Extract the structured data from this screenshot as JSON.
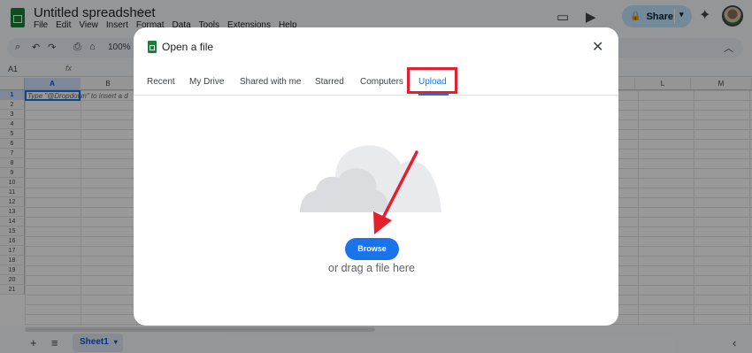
{
  "app": {
    "doc_title": "Untitled spreadsheet",
    "menu": [
      "File",
      "Edit",
      "View",
      "Insert",
      "Format",
      "Data",
      "Tools",
      "Extensions",
      "Help"
    ],
    "share_label": "Share",
    "zoom": "100%",
    "cell_ref": "A1",
    "fx": "fx",
    "cell_hint": "Type \"@Dropdown\" to insert a d",
    "columns": [
      "A",
      "B",
      "L",
      "M"
    ],
    "rows": [
      "1",
      "2",
      "3",
      "4",
      "5",
      "6",
      "7",
      "8",
      "9",
      "10",
      "11",
      "12",
      "13",
      "14",
      "15",
      "16",
      "17",
      "18",
      "19",
      "20",
      "21"
    ],
    "sheet_tab": "Sheet1",
    "icons": [
      "star-icon",
      "comment-icon",
      "meet-icon",
      "lock-icon",
      "gemini-icon",
      "search-icon",
      "undo-icon",
      "redo-icon",
      "print-icon",
      "paint-format-icon",
      "caret-up-icon",
      "add-sheet-icon",
      "sheets-menu-icon",
      "chevron-left-icon"
    ]
  },
  "dialog": {
    "title": "Open a file",
    "tabs": [
      "Recent",
      "My Drive",
      "Shared with me",
      "Starred",
      "Computers",
      "Upload"
    ],
    "active_tab": "Upload",
    "browse_label": "Browse",
    "drag_text": "or drag a file here"
  },
  "colors": {
    "accent": "#1a73e8",
    "highlight": "#e5202e",
    "sheets_green": "#188038"
  }
}
